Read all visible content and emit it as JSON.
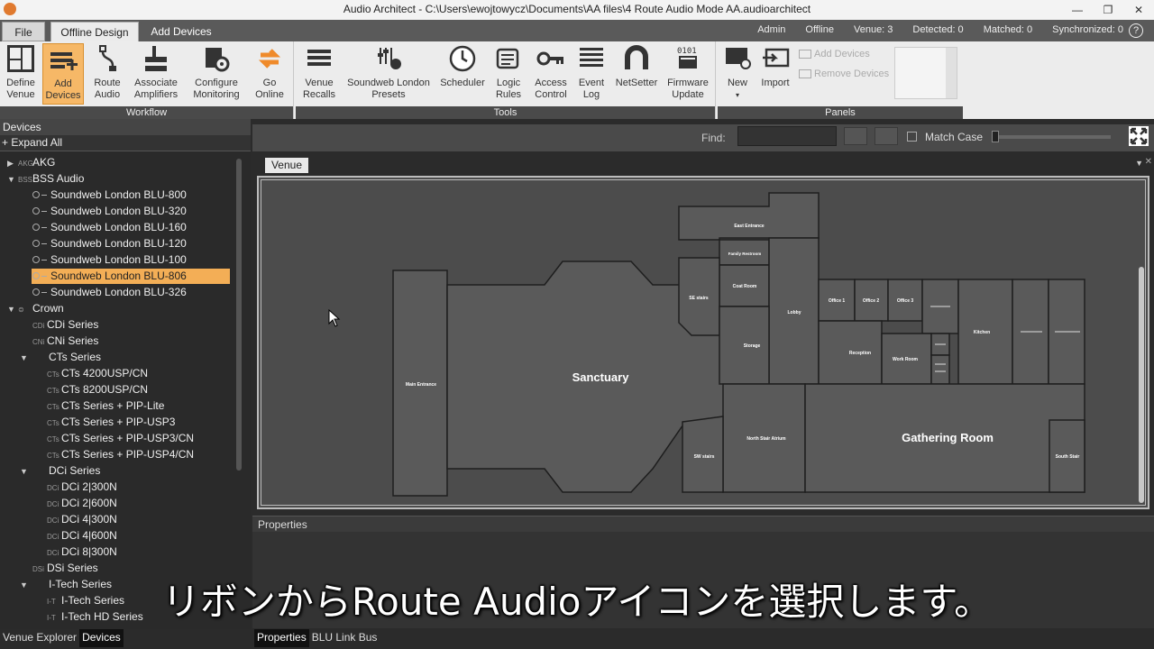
{
  "window": {
    "title": "Audio Architect - C:\\Users\\ewojtowycz\\Documents\\AA files\\4 Route Audio Mode AA.audioarchitect",
    "buttons": [
      "—",
      "❐",
      "✕"
    ]
  },
  "tabs": {
    "file": "File",
    "offline_design": "Offline Design",
    "add_devices": "Add Devices"
  },
  "status": {
    "user": "Admin",
    "mode": "Offline",
    "venue": "Venue: 3",
    "detected": "Detected: 0",
    "matched": "Matched: 0",
    "synchronized": "Synchronized: 0",
    "help": "?"
  },
  "ribbon": {
    "workflow_label": "Workflow",
    "tools_label": "Tools",
    "panels_label": "Panels",
    "workflow": [
      {
        "line1": "Define",
        "line2": "Venue"
      },
      {
        "line1": "Add",
        "line2": "Devices"
      },
      {
        "line1": "Route",
        "line2": "Audio"
      },
      {
        "line1": "Associate",
        "line2": "Amplifiers"
      },
      {
        "line1": "Configure",
        "line2": "Monitoring"
      },
      {
        "line1": "Go",
        "line2": "Online"
      }
    ],
    "tools": [
      {
        "line1": "Venue",
        "line2": "Recalls"
      },
      {
        "line1": "Soundweb London",
        "line2": "Presets"
      },
      {
        "line1": "Scheduler",
        "line2": ""
      },
      {
        "line1": "Logic",
        "line2": "Rules"
      },
      {
        "line1": "Access",
        "line2": "Control"
      },
      {
        "line1": "Event",
        "line2": "Log"
      },
      {
        "line1": "NetSetter",
        "line2": ""
      },
      {
        "line1": "Firmware",
        "line2": "Update"
      }
    ],
    "panels": {
      "new": "New",
      "import": "Import",
      "add_devices": "Add Devices",
      "remove_devices": "Remove Devices"
    }
  },
  "left_panel": {
    "header": "Devices",
    "expand_all": "+ Expand All",
    "tree": [
      {
        "label": "AKG",
        "prefix": "AKG",
        "type": "group-collapsed"
      },
      {
        "label": "BSS Audio",
        "prefix": "BSS",
        "type": "group-open"
      },
      {
        "label": "Soundweb London BLU-800",
        "type": "device"
      },
      {
        "label": "Soundweb London BLU-320",
        "type": "device"
      },
      {
        "label": "Soundweb London BLU-160",
        "type": "device"
      },
      {
        "label": "Soundweb London BLU-120",
        "type": "device"
      },
      {
        "label": "Soundweb London BLU-100",
        "type": "device"
      },
      {
        "label": "Soundweb London BLU-806",
        "type": "device",
        "selected": true
      },
      {
        "label": "Soundweb London BLU-326",
        "type": "device"
      },
      {
        "label": "Crown",
        "prefix": "⊜",
        "type": "group-open"
      },
      {
        "label": "CDi Series",
        "prefix": "CDi",
        "type": "series"
      },
      {
        "label": "CNi Series",
        "prefix": "CNi",
        "type": "series"
      },
      {
        "label": "CTs Series",
        "prefix": "",
        "type": "series-open"
      },
      {
        "label": "CTs 4200USP/CN",
        "prefix": "CTs",
        "type": "model"
      },
      {
        "label": "CTs 8200USP/CN",
        "prefix": "CTs",
        "type": "model"
      },
      {
        "label": "CTs Series + PIP-Lite",
        "prefix": "CTs",
        "type": "model"
      },
      {
        "label": "CTs Series + PIP-USP3",
        "prefix": "CTs",
        "type": "model"
      },
      {
        "label": "CTs Series + PIP-USP3/CN",
        "prefix": "CTs",
        "type": "model"
      },
      {
        "label": "CTs Series + PIP-USP4/CN",
        "prefix": "CTs",
        "type": "model"
      },
      {
        "label": "DCi Series",
        "prefix": "",
        "type": "series-open"
      },
      {
        "label": "DCi 2|300N",
        "prefix": "DCi",
        "type": "model"
      },
      {
        "label": "DCi 2|600N",
        "prefix": "DCi",
        "type": "model"
      },
      {
        "label": "DCi 4|300N",
        "prefix": "DCi",
        "type": "model"
      },
      {
        "label": "DCi 4|600N",
        "prefix": "DCi",
        "type": "model"
      },
      {
        "label": "DCi 8|300N",
        "prefix": "DCi",
        "type": "model"
      },
      {
        "label": "DSi Series",
        "prefix": "DSi",
        "type": "series"
      },
      {
        "label": "I-Tech Series",
        "prefix": "",
        "type": "series-open"
      },
      {
        "label": "I-Tech Series",
        "prefix": "I-T",
        "type": "model"
      },
      {
        "label": "I-Tech HD Series",
        "prefix": "I-T",
        "type": "model"
      }
    ],
    "bottom_tabs": [
      "Venue Explorer",
      "Devices"
    ]
  },
  "find": {
    "label": "Find:",
    "match_case": "Match Case"
  },
  "venue_tab": "Venue",
  "rooms": {
    "sanctuary": "Sanctuary",
    "gathering": "Gathering Room",
    "main_entrance": "Main Entrance",
    "east_entrance": "East Entrance",
    "family_restroom": "Family Restroom",
    "coat_room": "Coat Room",
    "se_stairs": "SE stairs",
    "lobby": "Lobby",
    "storage": "Storage",
    "office1": "Office 1",
    "office2": "Office 2",
    "office3": "Office 3",
    "reception": "Reception",
    "work_room": "Work Room",
    "kitchen": "Kitchen",
    "north_stair": "North Stair Atrium",
    "sw_stairs": "SW stairs",
    "south_stair": "South Stair"
  },
  "properties": {
    "header": "Properties",
    "bottom_tabs": [
      "Properties",
      "BLU Link Bus"
    ]
  },
  "subtitle": "リボンからRoute Audioアイコンを選択します。",
  "colors": {
    "accent": "#f3ae56",
    "canvas": "#4c4c4c",
    "room": "#5a5a5a"
  }
}
